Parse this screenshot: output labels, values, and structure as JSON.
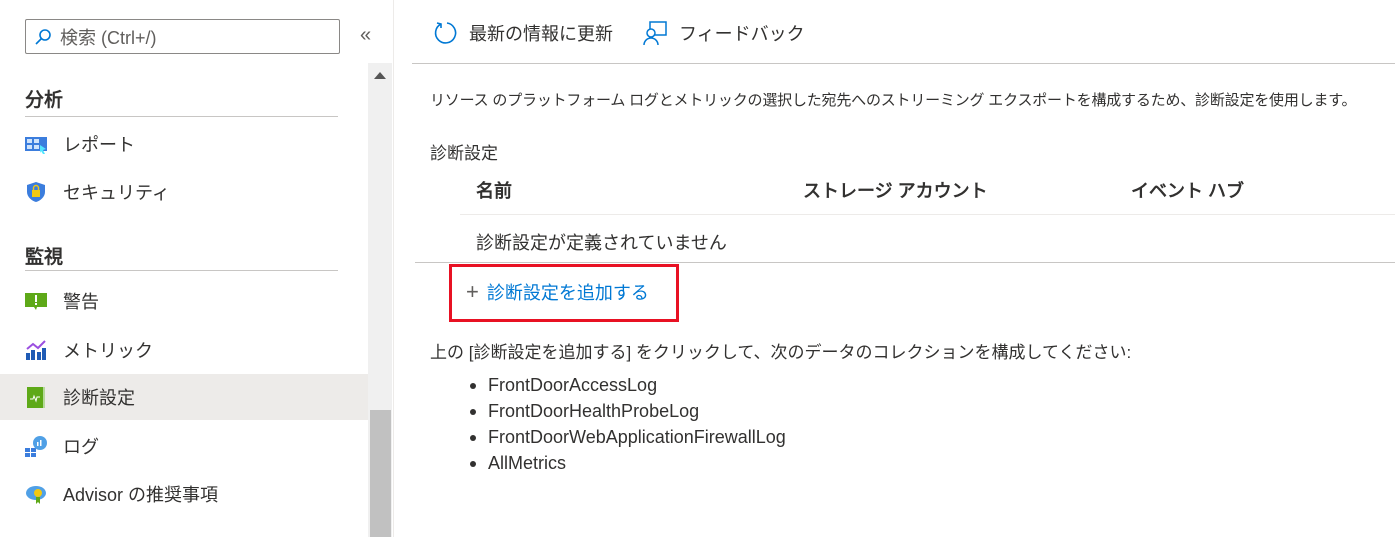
{
  "sidebar": {
    "search_placeholder": "検索 (Ctrl+/)",
    "collapse": "«",
    "sections": [
      {
        "title": "分析",
        "items": [
          {
            "label": "レポート",
            "icon": "report-icon"
          },
          {
            "label": "セキュリティ",
            "icon": "shield-lock-icon"
          }
        ]
      },
      {
        "title": "監視",
        "items": [
          {
            "label": "警告",
            "icon": "alert-icon"
          },
          {
            "label": "メトリック",
            "icon": "metrics-icon"
          },
          {
            "label": "診断設定",
            "icon": "diagnostic-settings-icon",
            "selected": true
          },
          {
            "label": "ログ",
            "icon": "logs-icon"
          },
          {
            "label": "Advisor の推奨事項",
            "icon": "advisor-icon"
          }
        ]
      }
    ]
  },
  "toolbar": {
    "refresh": "最新の情報に更新",
    "feedback": "フィードバック"
  },
  "main": {
    "description": "リソース のプラットフォーム ログとメトリックの選択した宛先へのストリーミング エクスポートを構成するため、診断設定を使用します。",
    "section_title": "診断設定",
    "table": {
      "headers": [
        "名前",
        "ストレージ アカウント",
        "イベント ハブ"
      ],
      "empty": "診断設定が定義されていません"
    },
    "add_button": "診断設定を追加する",
    "instruction": "上の [診断設定を追加する] をクリックして、次のデータのコレクションを構成してください:",
    "logs": [
      "FrontDoorAccessLog",
      "FrontDoorHealthProbeLog",
      "FrontDoorWebApplicationFirewallLog",
      "AllMetrics"
    ]
  },
  "colors": {
    "accent": "#0078d4",
    "highlight": "#e81123",
    "selected": "#edebe9"
  }
}
